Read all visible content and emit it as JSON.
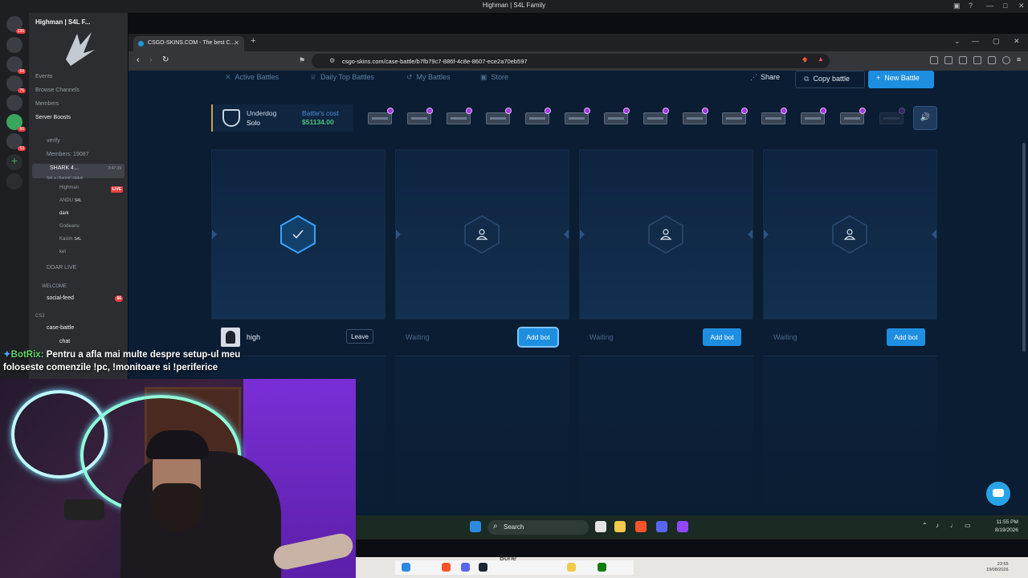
{
  "os_window": {
    "title": "Highman | S4L Family"
  },
  "discord": {
    "server_name": "Highman | S4L F...",
    "guild_badges": [
      "136",
      "64",
      "76",
      "66",
      "53"
    ],
    "channels": [
      {
        "label": "Events",
        "style": "dim"
      },
      {
        "label": "Browse Channels",
        "style": "dim"
      },
      {
        "label": "Members",
        "style": "dim"
      },
      {
        "label": "Server Boosts",
        "style": "bright"
      },
      {
        "label": "verify",
        "style": "dim"
      },
      {
        "label": "Members: 19087",
        "style": "dim"
      },
      {
        "label": "SHARK 4...",
        "style": "bright"
      },
      {
        "label": "Set a channel status",
        "style": "dim"
      },
      {
        "label": "Highman",
        "style": "dim"
      },
      {
        "label": "ANDU",
        "style": "dim"
      },
      {
        "label": "dark",
        "style": "bright"
      },
      {
        "label": "Godeanu",
        "style": "dim"
      },
      {
        "label": "Kasim",
        "style": "dim"
      },
      {
        "label": "ket",
        "style": "dim"
      },
      {
        "label": "DOAR LIVE",
        "style": "dim"
      },
      {
        "label": "WELCOME",
        "style": "dim"
      },
      {
        "label": "social-feed",
        "style": "bright"
      },
      {
        "label": "CS2",
        "style": "dim"
      },
      {
        "label": "case-battle",
        "style": "bright"
      },
      {
        "label": "chat",
        "style": "bright"
      }
    ],
    "voice_timer": "3:47:39",
    "live_label": "LIVE",
    "s4l_tag": "S4L",
    "social_badge": "66"
  },
  "browser": {
    "tab_title": "CSGO-SKINS.COM - The best C...",
    "url": "csgo-skins.com/case-battle/b7fb79c7-886f-4c8e-8607-ece2a70eb597"
  },
  "site": {
    "nav": [
      "Active Battles",
      "Daily Top Battles",
      "My Battles",
      "Store"
    ],
    "share": "Share",
    "copy_battle": "Copy battle",
    "new_battle": "New Battle",
    "info": {
      "mode_title": "Underdog",
      "mode": "Solo",
      "cost_label": "Battle's cost",
      "cost": "$51134.00"
    },
    "case_count": 14,
    "slots": [
      {
        "state": "joined",
        "player": "high",
        "action": "Leave"
      },
      {
        "state": "waiting",
        "status": "Waiting",
        "action": "Add bot"
      },
      {
        "state": "waiting",
        "status": "Waiting",
        "action": "Add bot"
      },
      {
        "state": "waiting",
        "status": "Waiting",
        "action": "Add bot"
      }
    ]
  },
  "overlay": {
    "bot_name": "BotRix:",
    "line1": "Pentru a afla mai multe despre setup-ul meu",
    "line2": "foloseste comenzile !pc, !monitoare si !periferice"
  },
  "taskbar": {
    "search": "Search",
    "time": "11:55 PM",
    "date": "8/19/2026",
    "time2": "23:55",
    "date2": "19/08/2026",
    "overlay_text": "Bone"
  },
  "colors": {
    "accent": "#1e8fe0",
    "cost": "#4ec37f",
    "case_badge": "#a238d8",
    "site_bg": "#0b1d33"
  }
}
